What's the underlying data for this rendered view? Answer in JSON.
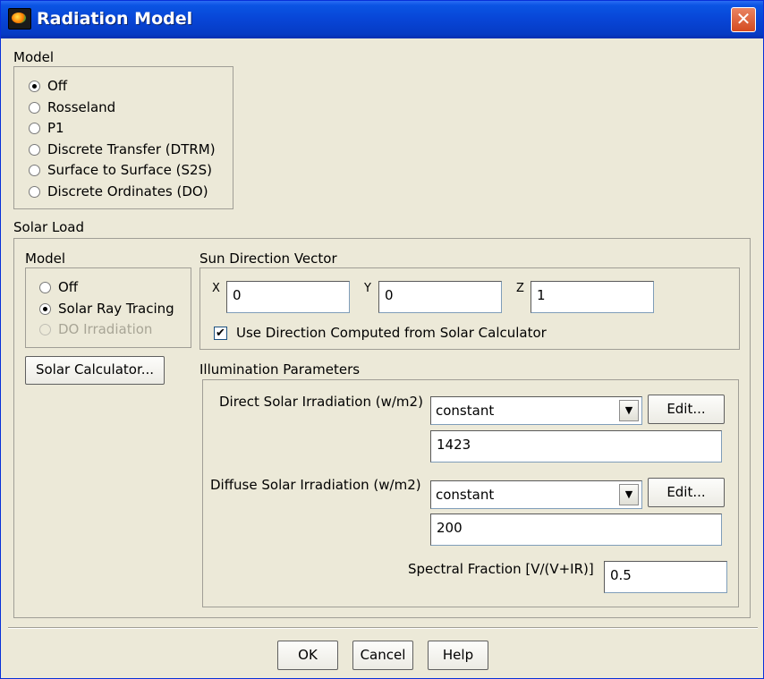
{
  "window": {
    "title": "Radiation Model",
    "close_glyph": "✕"
  },
  "model": {
    "label": "Model",
    "options": [
      {
        "label": "Off",
        "selected": true
      },
      {
        "label": "Rosseland",
        "selected": false
      },
      {
        "label": "P1",
        "selected": false
      },
      {
        "label": "Discrete Transfer (DTRM)",
        "selected": false
      },
      {
        "label": "Surface to Surface (S2S)",
        "selected": false
      },
      {
        "label": "Discrete Ordinates (DO)",
        "selected": false
      }
    ]
  },
  "solar_load": {
    "label": "Solar Load",
    "model": {
      "label": "Model",
      "options": [
        {
          "label": "Off",
          "selected": false
        },
        {
          "label": "Solar Ray Tracing",
          "selected": true
        },
        {
          "label": "DO Irradiation",
          "selected": false,
          "disabled": true
        }
      ]
    },
    "solar_calculator_button": "Solar Calculator...",
    "sun_direction": {
      "label": "Sun Direction Vector",
      "x_label": "X",
      "x_value": "0",
      "y_label": "Y",
      "y_value": "0",
      "z_label": "Z",
      "z_value": "1",
      "use_computed_label": "Use Direction Computed from Solar Calculator",
      "use_computed_checked": true
    },
    "illumination": {
      "label": "Illumination Parameters",
      "direct": {
        "label": "Direct Solar Irradiation (w/m2)",
        "method": "constant",
        "value": "1423",
        "edit_label": "Edit..."
      },
      "diffuse": {
        "label": "Diffuse Solar Irradiation (w/m2)",
        "method": "constant",
        "value": "200",
        "edit_label": "Edit..."
      },
      "spectral": {
        "label": "Spectral Fraction [V/(V+IR)]",
        "value": "0.5"
      }
    }
  },
  "footer": {
    "ok": "OK",
    "cancel": "Cancel",
    "help": "Help"
  },
  "icons": {
    "dropdown_arrow": "▼",
    "checkmark": "✔"
  }
}
